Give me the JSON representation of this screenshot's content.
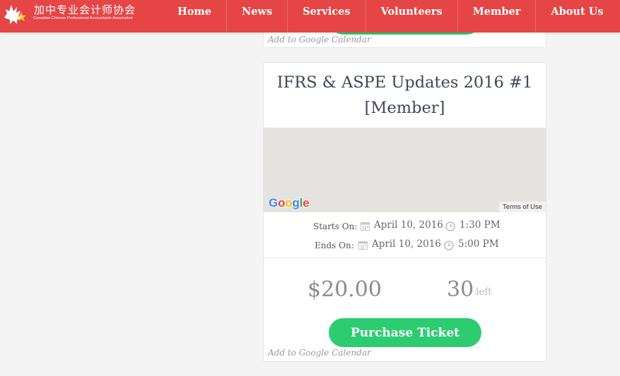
{
  "brand": {
    "name_cn": "加中专业会计师协会",
    "name_en": "Canadian-Chinese Professional Accountants Association",
    "color": "#e54545"
  },
  "nav": {
    "items": [
      {
        "label": "Home"
      },
      {
        "label": "News"
      },
      {
        "label": "Services"
      },
      {
        "label": "Volunteers"
      },
      {
        "label": "Member"
      },
      {
        "label": "About Us"
      }
    ]
  },
  "prev_event": {
    "gcal_label": "Add to Google Calendar"
  },
  "event": {
    "title": "IFRS & ASPE Updates 2016 #1 [Member]",
    "map": {
      "provider": "Google",
      "terms_label": "Terms of Use"
    },
    "starts": {
      "label": "Starts On:",
      "date": "April 10, 2016",
      "time": "1:30 PM"
    },
    "ends": {
      "label": "Ends On:",
      "date": "April 10, 2016",
      "time": "5:00 PM"
    },
    "price": "$20.00",
    "tickets_left": "30",
    "left_label": "left",
    "purchase_label": "Purchase Ticket",
    "gcal_label": "Add to Google Calendar",
    "accent_color": "#2ecc71"
  }
}
